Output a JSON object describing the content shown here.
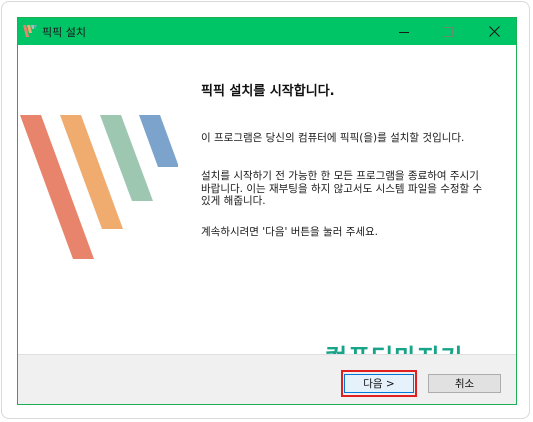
{
  "window": {
    "title": "픽픽 설치"
  },
  "content": {
    "heading": "픽픽 설치를 시작합니다.",
    "paragraph1": "이 프로그램은 당신의 컴퓨터에 픽픽(을)를 설치할 것입니다.",
    "paragraph2": "설치를 시작하기 전 가능한 한 모든 프로그램을 종료하여 주시기 바랍니다. 이는 재부팅을 하지 않고서도 시스템 파일을 수정할 수 있게 해줍니다.",
    "paragraph3": "계속하시려면 '다음' 버튼을 눌러 주세요.",
    "watermark": "컴퓨터마지기"
  },
  "footer": {
    "next_label": "다음 >",
    "cancel_label": "취소"
  },
  "colors": {
    "titlebar": "#00c567",
    "stripe_1": "#e8846b",
    "stripe_2": "#f0ab6f",
    "stripe_3": "#9ec7b2",
    "stripe_4": "#7ba3cc",
    "highlight": "#e02020",
    "watermark": "#18a489"
  },
  "icons": {
    "app": "picpick-logo-icon",
    "minimize": "minimize-icon",
    "maximize": "maximize-icon",
    "close": "close-icon"
  }
}
